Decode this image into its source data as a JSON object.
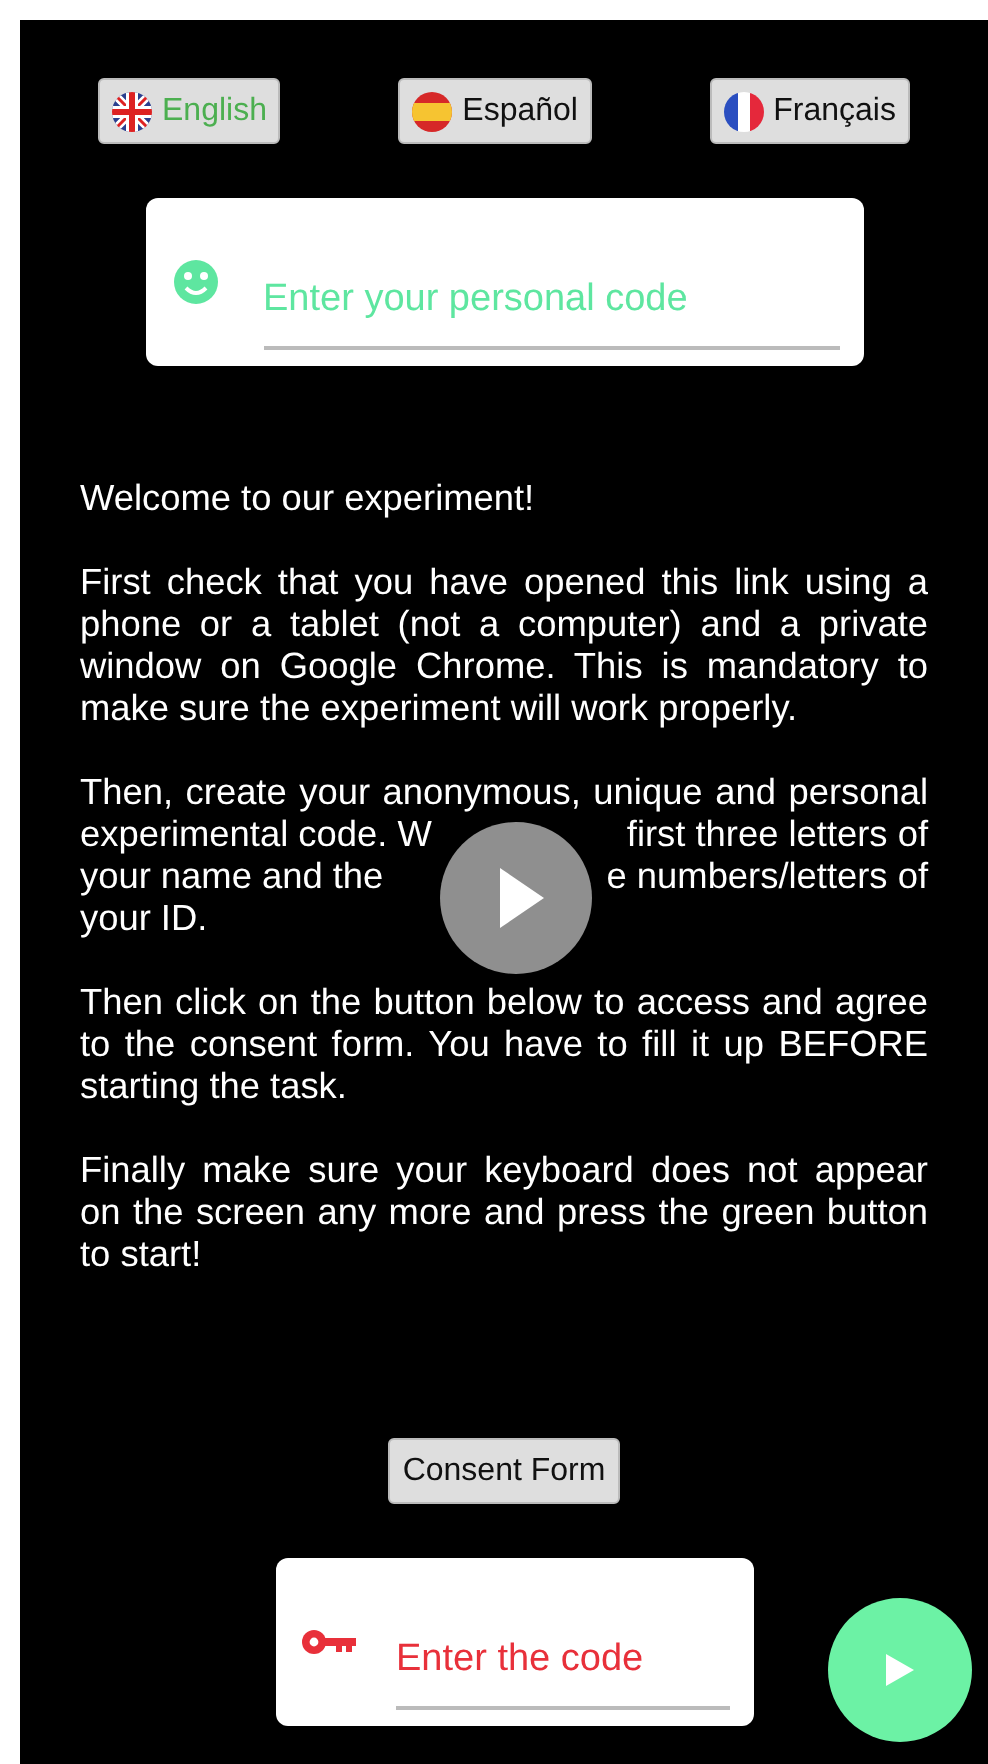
{
  "languages": [
    {
      "label": "English",
      "kind": "uk",
      "selected": true
    },
    {
      "label": "Español",
      "kind": "es",
      "selected": false
    },
    {
      "label": "Français",
      "kind": "fr",
      "selected": false
    }
  ],
  "personal_code": {
    "placeholder": "Enter your personal code"
  },
  "paragraphs": [
    {
      "kind": "text",
      "text": "Welcome to our experiment!"
    },
    {
      "kind": "text",
      "text": "First check that you have opened this link using a phone or a tablet (not a computer) and a private window on Google Chrome. This is mandatory to make sure the experiment will work properly."
    },
    {
      "kind": "lines",
      "lines": [
        {
          "parts": [
            "Then, create your anonymous, unique and personal"
          ]
        },
        {
          "parts": [
            "experimental code. W",
            "first three letters of"
          ]
        },
        {
          "parts": [
            "your name and the",
            "e numbers/letters of"
          ]
        },
        {
          "parts": [
            "your ID."
          ]
        }
      ]
    },
    {
      "kind": "text",
      "text": "Then click on the button below to access and agree to the consent form. You have to fill it up BEFORE starting the task."
    },
    {
      "kind": "text",
      "text": "Finally make sure your keyboard does not appear on the screen any more and press the green button to start!"
    }
  ],
  "consent_button": "Consent Form",
  "code_field": {
    "placeholder": "Enter the code"
  }
}
